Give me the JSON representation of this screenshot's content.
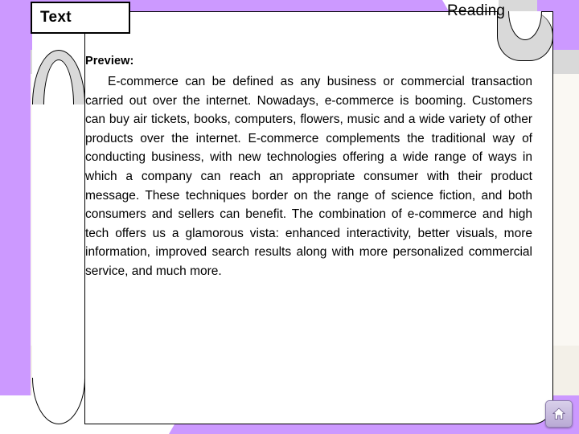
{
  "slide": {
    "title": "Text",
    "header_right": "Reading",
    "preview_label": "Preview:",
    "body_text": "E-commerce can be defined as any business or commercial transaction carried out over the internet. Nowadays, e-commerce is booming. Customers can buy air tickets, books, computers, flowers, music and a wide variety of other products over the internet. E-commerce complements the traditional way of conducting business, with new technologies offering a wide range of ways in which a company can reach an appropriate consumer with their product message. These techniques border on the range of science fiction, and both consumers and sellers can benefit.  The combination of e-commerce and high tech offers us a glamorous vista: enhanced interactivity, better visuals, more information, improved search results along with more personalized commercial service, and much more.",
    "nav_button_icon": "home-icon",
    "colors": {
      "accent_violet": "#cc99ff",
      "band_gray": "#d9d9d9",
      "paper": "#ffffff",
      "text": "#000000"
    }
  }
}
